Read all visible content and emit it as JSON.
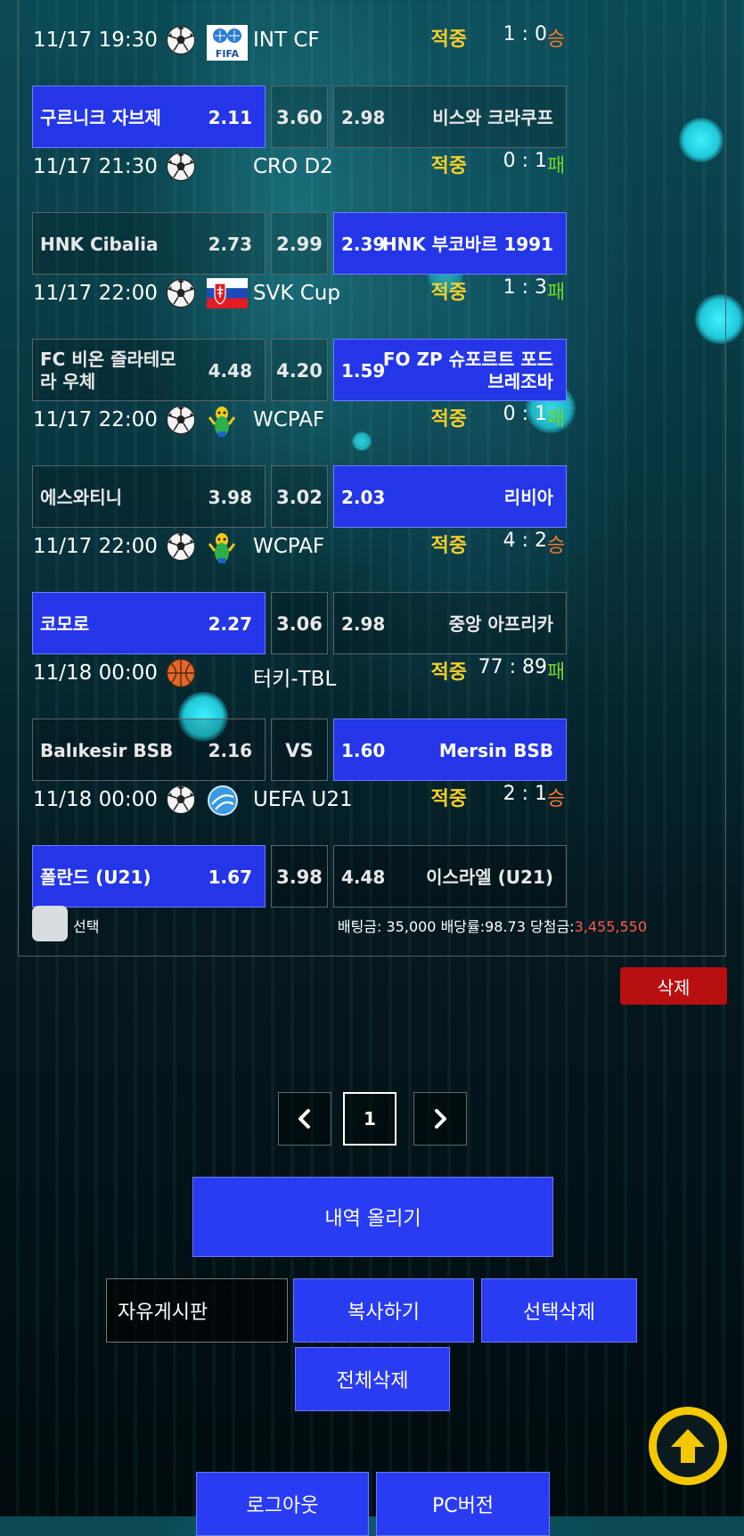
{
  "hit_label": "적중",
  "matches": [
    {
      "time": "11/17 19:30",
      "ball_icon": "soccer-ball-icon",
      "flag_icon": "fifa-logo-icon",
      "league": "INT CF",
      "score": "1 : 0",
      "result": "승",
      "result_type": "win",
      "home": {
        "name": "구르니크 자브제",
        "odds": "2.11"
      },
      "draw": "3.60",
      "away": {
        "name": "비스와 크라쿠프",
        "odds": "2.98"
      },
      "selected": "home"
    },
    {
      "time": "11/17 21:30",
      "ball_icon": "soccer-ball-icon",
      "flag_icon": "",
      "league": "CRO D2",
      "score": "0 : 1",
      "result": "패",
      "result_type": "lose",
      "home": {
        "name": "HNK Cibalia",
        "odds": "2.73"
      },
      "draw": "2.99",
      "away": {
        "name": "HNK 부코바르 1991",
        "odds": "2.39"
      },
      "selected": "away"
    },
    {
      "time": "11/17 22:00",
      "ball_icon": "soccer-ball-icon",
      "flag_icon": "slovakia-flag-icon",
      "league": "SVK Cup",
      "score": "1 : 3",
      "result": "패",
      "result_type": "lose",
      "home": {
        "name": "FC 비온 즐라테모라 우체",
        "odds": "4.48"
      },
      "draw": "4.20",
      "away": {
        "name": "FO ZP 슈포르트 포드브레조바",
        "odds": "1.59"
      },
      "selected": "away"
    },
    {
      "time": "11/17 22:00",
      "ball_icon": "soccer-ball-icon",
      "flag_icon": "world-cup-mascot-icon",
      "league": "WCPAF",
      "score": "0 : 1",
      "result": "패",
      "result_type": "lose",
      "home": {
        "name": "에스와티니",
        "odds": "3.98"
      },
      "draw": "3.02",
      "away": {
        "name": "리비아",
        "odds": "2.03"
      },
      "selected": "away"
    },
    {
      "time": "11/17 22:00",
      "ball_icon": "soccer-ball-icon",
      "flag_icon": "world-cup-mascot-icon",
      "league": "WCPAF",
      "score": "4 : 2",
      "result": "승",
      "result_type": "win",
      "home": {
        "name": "코모로",
        "odds": "2.27"
      },
      "draw": "3.06",
      "away": {
        "name": "중앙 아프리카",
        "odds": "2.98"
      },
      "selected": "home"
    },
    {
      "time": "11/18 00:00",
      "ball_icon": "basketball-icon",
      "flag_icon": "",
      "league": "터키-TBL",
      "score": "77 : 89",
      "result": "패",
      "result_type": "lose",
      "home": {
        "name": "Balıkesir BSB",
        "odds": "2.16"
      },
      "draw": "VS",
      "away": {
        "name": "Mersin BSB",
        "odds": "1.60"
      },
      "selected": "away"
    },
    {
      "time": "11/18 00:00",
      "ball_icon": "soccer-ball-icon",
      "flag_icon": "uefa-logo-icon",
      "league": "UEFA U21",
      "score": "2 : 1",
      "result": "승",
      "result_type": "win",
      "home": {
        "name": "폴란드 (U21)",
        "odds": "1.67"
      },
      "draw": "3.98",
      "away": {
        "name": "이스라엘 (U21)",
        "odds": "4.48"
      },
      "selected": "home"
    }
  ],
  "select_label": "선택",
  "summary": {
    "bet_label": "배팅금: 35,000 배당률:98.73 당첨금:",
    "win_amount": "3,455,550"
  },
  "delete_label": "삭제",
  "pagination": {
    "current": "1",
    "prev_icon": "chevron-left-icon",
    "next_icon": "chevron-right-icon"
  },
  "buttons": {
    "upload_history": "내역 올리기",
    "free_board": "자유게시판",
    "copy": "복사하기",
    "delete_selected": "선택삭제",
    "delete_all": "전체삭제",
    "logout": "로그아웃",
    "pc_version": "PC버전"
  },
  "scroll_top_icon": "arrow-up-icon",
  "colors": {
    "selected": "#2436e8",
    "hit": "#f5cf2a",
    "win": "#f27a2c",
    "lose": "#6fd42a",
    "delete": "#b80f10",
    "scroll_top": "#f3c800"
  }
}
